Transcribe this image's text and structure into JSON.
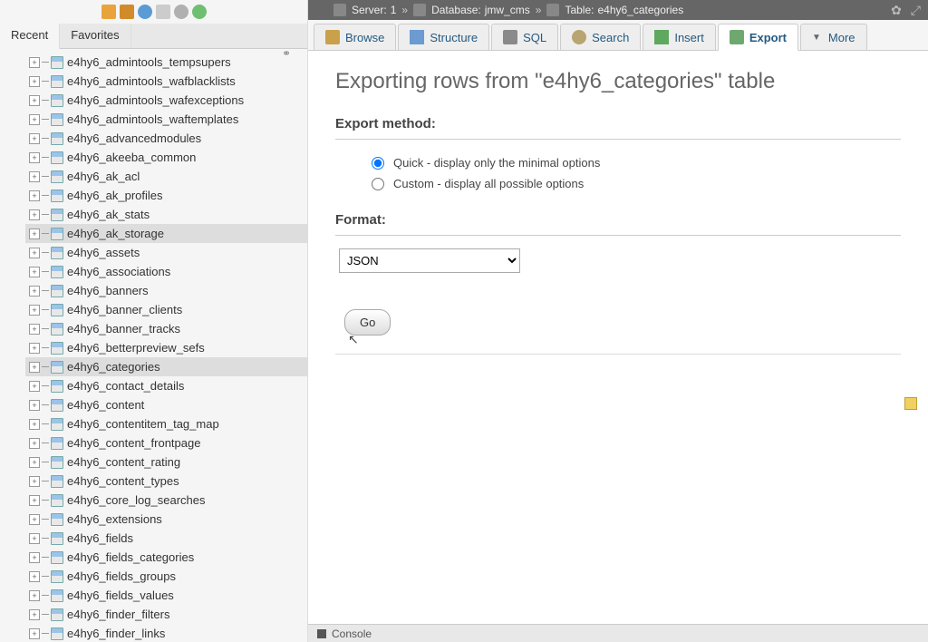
{
  "sidebar": {
    "tabs": {
      "recent": "Recent",
      "favorites": "Favorites"
    },
    "tables": [
      {
        "name": "e4hy6_admintools_tempsupers"
      },
      {
        "name": "e4hy6_admintools_wafblacklists"
      },
      {
        "name": "e4hy6_admintools_wafexceptions"
      },
      {
        "name": "e4hy6_admintools_waftemplates"
      },
      {
        "name": "e4hy6_advancedmodules"
      },
      {
        "name": "e4hy6_akeeba_common"
      },
      {
        "name": "e4hy6_ak_acl"
      },
      {
        "name": "e4hy6_ak_profiles"
      },
      {
        "name": "e4hy6_ak_stats"
      },
      {
        "name": "e4hy6_ak_storage",
        "selected": true
      },
      {
        "name": "e4hy6_assets"
      },
      {
        "name": "e4hy6_associations"
      },
      {
        "name": "e4hy6_banners"
      },
      {
        "name": "e4hy6_banner_clients"
      },
      {
        "name": "e4hy6_banner_tracks"
      },
      {
        "name": "e4hy6_betterpreview_sefs"
      },
      {
        "name": "e4hy6_categories",
        "selected": true
      },
      {
        "name": "e4hy6_contact_details"
      },
      {
        "name": "e4hy6_content"
      },
      {
        "name": "e4hy6_contentitem_tag_map"
      },
      {
        "name": "e4hy6_content_frontpage"
      },
      {
        "name": "e4hy6_content_rating"
      },
      {
        "name": "e4hy6_content_types"
      },
      {
        "name": "e4hy6_core_log_searches"
      },
      {
        "name": "e4hy6_extensions"
      },
      {
        "name": "e4hy6_fields"
      },
      {
        "name": "e4hy6_fields_categories"
      },
      {
        "name": "e4hy6_fields_groups"
      },
      {
        "name": "e4hy6_fields_values"
      },
      {
        "name": "e4hy6_finder_filters"
      },
      {
        "name": "e4hy6_finder_links"
      }
    ]
  },
  "breadcrumb": {
    "server_label": "Server:",
    "server_value": "1",
    "db_label": "Database:",
    "db_value": "jmw_cms",
    "table_label": "Table:",
    "table_value": "e4hy6_categories"
  },
  "tabs": {
    "browse": "Browse",
    "structure": "Structure",
    "sql": "SQL",
    "search": "Search",
    "insert": "Insert",
    "export": "Export",
    "more": "More"
  },
  "page": {
    "heading": "Exporting rows from \"e4hy6_categories\" table",
    "export_method_legend": "Export method:",
    "quick_label": "Quick - display only the minimal options",
    "custom_label": "Custom - display all possible options",
    "format_legend": "Format:",
    "format_value": "JSON",
    "go": "Go"
  },
  "console": {
    "label": "Console"
  }
}
